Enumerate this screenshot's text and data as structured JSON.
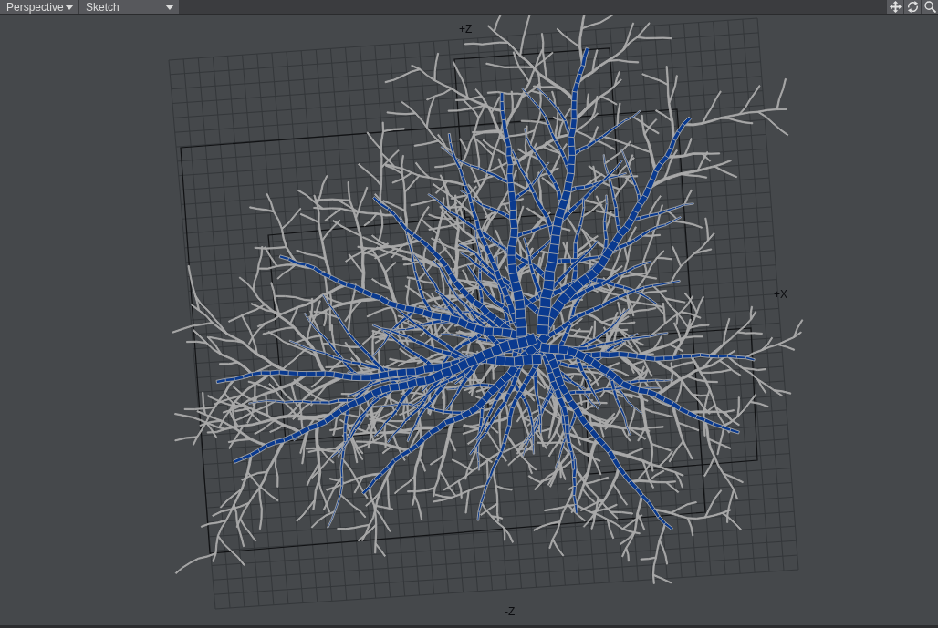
{
  "viewport": {
    "view_menu": {
      "label": "Perspective"
    },
    "display_menu": {
      "label": "Sketch"
    },
    "axis_labels": [
      "+Z",
      "+X",
      "-Z"
    ]
  }
}
